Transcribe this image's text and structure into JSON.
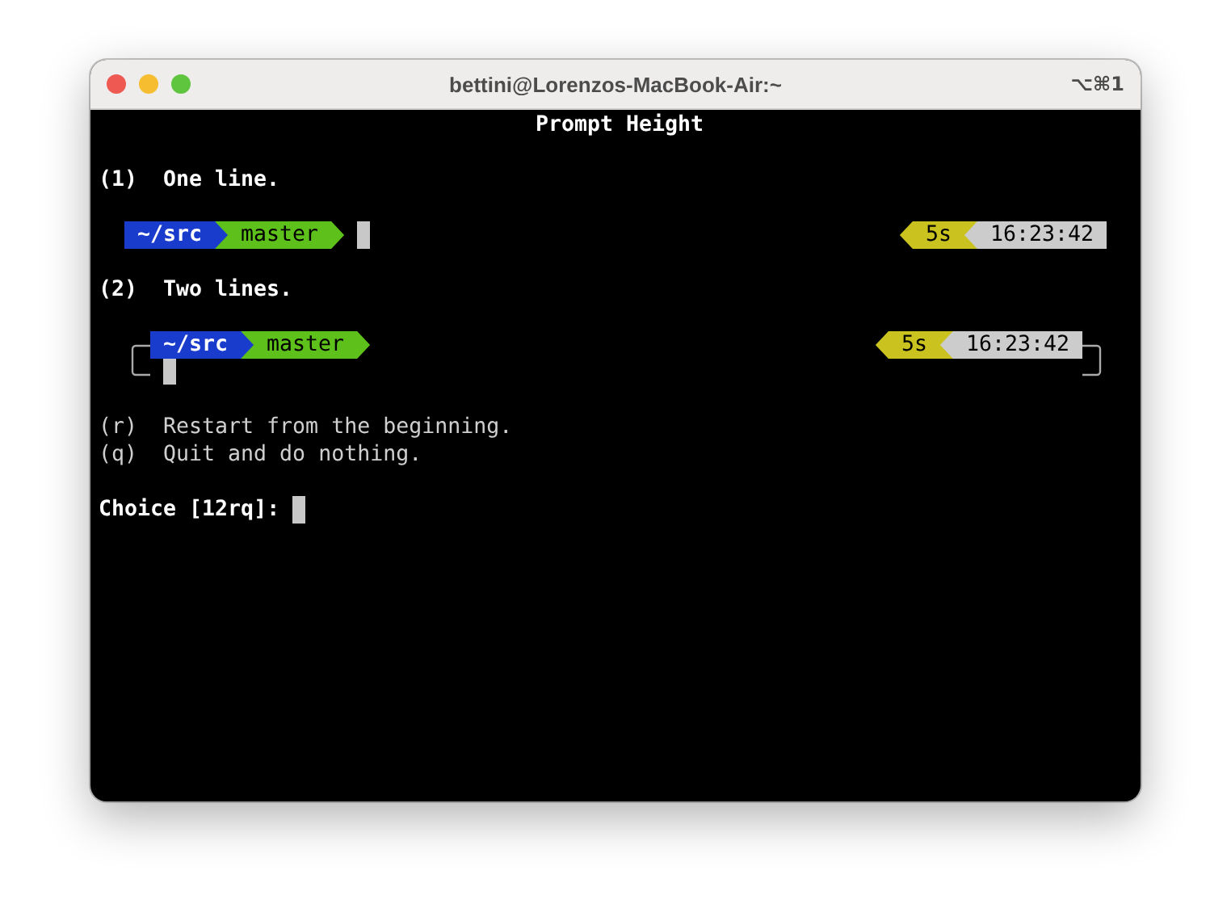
{
  "window": {
    "title": "bettini@Lorenzos-MacBook-Air:~",
    "shortcut": "⌥⌘1"
  },
  "heading": "Prompt Height",
  "sections": [
    {
      "label": "(1)",
      "text": "One line.",
      "prompt": {
        "kind": "one_line",
        "left": [
          {
            "text": "~/src",
            "color": "#1a3ccc"
          },
          {
            "text": "master",
            "color": "#5ec01a"
          }
        ],
        "right": [
          {
            "text": "5s",
            "color": "#c9c21f"
          },
          {
            "text": "16:23:42",
            "color": "#cccccc"
          }
        ]
      }
    },
    {
      "label": "(2)",
      "text": "Two lines.",
      "prompt": {
        "kind": "two_lines",
        "left": [
          {
            "text": "~/src",
            "color": "#1a3ccc"
          },
          {
            "text": "master",
            "color": "#5ec01a"
          }
        ],
        "right": [
          {
            "text": "5s",
            "color": "#c9c21f"
          },
          {
            "text": "16:23:42",
            "color": "#cccccc"
          }
        ]
      }
    }
  ],
  "options": [
    {
      "key": "(r)",
      "text": "Restart from the beginning."
    },
    {
      "key": "(q)",
      "text": "Quit and do nothing."
    }
  ],
  "input": {
    "label": "Choice [12rq]:"
  }
}
